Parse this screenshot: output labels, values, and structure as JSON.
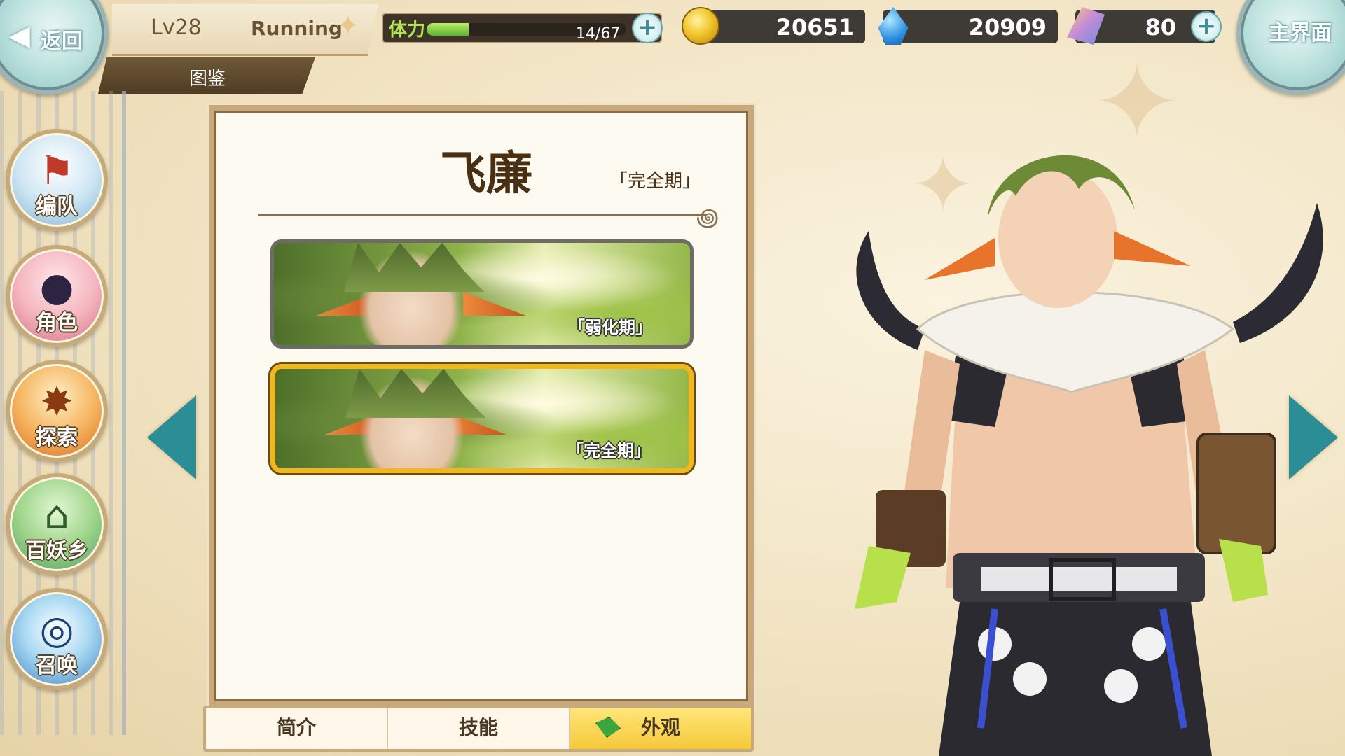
{
  "header": {
    "back_label": "返回",
    "level": "Lv28",
    "player_name": "Running",
    "section_title": "图鉴",
    "home_label": "主界面"
  },
  "stamina": {
    "label": "体力",
    "value_text": "14/67",
    "fraction": 0.21
  },
  "currencies": {
    "gold": "20651",
    "spirit": "20909",
    "crystal": "80"
  },
  "nav": {
    "items": [
      {
        "label": "编队",
        "icon": "team-icon"
      },
      {
        "label": "角色",
        "icon": "character-icon"
      },
      {
        "label": "探索",
        "icon": "explore-icon"
      },
      {
        "label": "百妖乡",
        "icon": "village-icon"
      },
      {
        "label": "召唤",
        "icon": "summon-icon"
      }
    ]
  },
  "character": {
    "name": "飞廉",
    "stage": "「完全期」"
  },
  "skins": [
    {
      "stage": "「弱化期」",
      "selected": false
    },
    {
      "stage": "「完全期」",
      "selected": true
    }
  ],
  "tabs": [
    {
      "label": "简介",
      "active": false
    },
    {
      "label": "技能",
      "active": false
    },
    {
      "label": "外观",
      "active": true
    }
  ],
  "colors": {
    "accent_gold": "#f1b71d",
    "teal_arrow": "#2b8d96",
    "stamina_green": "#7fcf3a"
  }
}
